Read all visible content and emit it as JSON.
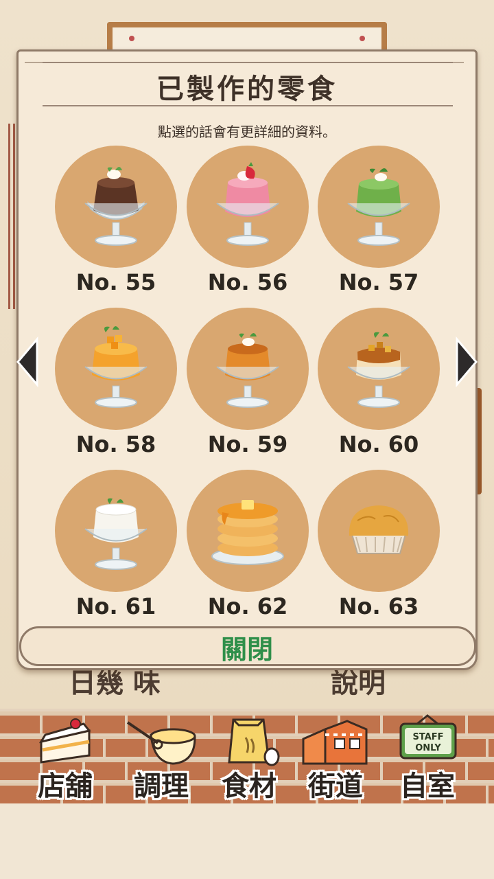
{
  "dialog": {
    "title": "已製作的零食",
    "subtitle": "點選的話會有更詳細的資料。",
    "close_label": "關閉"
  },
  "background": {
    "under_left": "日幾 味",
    "under_right": "說明"
  },
  "items": [
    {
      "label": "No. 55",
      "icon": "chocolate-pudding-icon"
    },
    {
      "label": "No. 56",
      "icon": "strawberry-mousse-icon"
    },
    {
      "label": "No. 57",
      "icon": "matcha-jelly-icon"
    },
    {
      "label": "No. 58",
      "icon": "mango-pudding-icon"
    },
    {
      "label": "No. 59",
      "icon": "caramel-pudding-icon"
    },
    {
      "label": "No. 60",
      "icon": "fruit-flan-icon"
    },
    {
      "label": "No. 61",
      "icon": "milk-pudding-icon"
    },
    {
      "label": "No. 62",
      "icon": "pancake-stack-icon"
    },
    {
      "label": "No. 63",
      "icon": "muffin-icon"
    }
  ],
  "nav": [
    {
      "label": "店舖",
      "icon": "cake-slice-icon"
    },
    {
      "label": "調理",
      "icon": "mixing-bowl-icon"
    },
    {
      "label": "食材",
      "icon": "flour-bag-icon"
    },
    {
      "label": "街道",
      "icon": "street-shops-icon"
    },
    {
      "label": "自室",
      "icon": "staff-only-sign-icon"
    }
  ],
  "staff_sign_text": "STAFF ONLY",
  "colors": {
    "circle": "#d9a770",
    "panel": "#f6ead8",
    "close_green": "#2f8f4a",
    "brick": "#c0734c"
  }
}
